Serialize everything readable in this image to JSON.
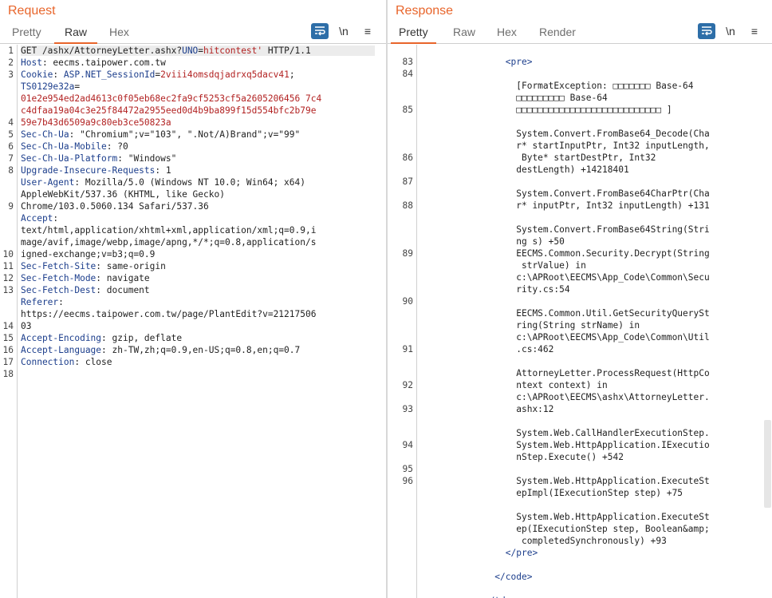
{
  "request": {
    "title": "Request",
    "tabs": [
      "Pretty",
      "Raw",
      "Hex"
    ],
    "active_tab": "Raw",
    "tools": {
      "newline": "\\n",
      "menu": "≡"
    },
    "line_numbers": [
      "1",
      "2",
      "3",
      "",
      "",
      "",
      "4",
      "5",
      "6",
      "7",
      "8",
      "",
      "",
      "9",
      "",
      "",
      "",
      "10",
      "11",
      "12",
      "13",
      "",
      "",
      "14",
      "15",
      "16",
      "17",
      "18"
    ],
    "rows": [
      {
        "parts": [
          [
            "m",
            "GET /ashx/AttorneyLetter.ashx?"
          ],
          [
            "k",
            "UNO"
          ],
          [
            "m",
            "="
          ],
          [
            "v",
            "hitcontest'"
          ],
          [
            "m",
            " HTTP/1.1"
          ]
        ]
      },
      {
        "parts": [
          [
            "k",
            "Host"
          ],
          [
            "m",
            ": eecms.taipower.com.tw"
          ]
        ]
      },
      {
        "parts": [
          [
            "k",
            "Cookie"
          ],
          [
            "m",
            ": "
          ],
          [
            "k",
            "ASP.NET_SessionId"
          ],
          [
            "m",
            "="
          ],
          [
            "v",
            "2viii4omsdqjadrxq5dacv41"
          ],
          [
            "m",
            ";"
          ]
        ]
      },
      {
        "parts": [
          [
            "k",
            "TS0129e32a"
          ],
          [
            "m",
            "="
          ]
        ]
      },
      {
        "parts": [
          [
            "v",
            "01e2e954ed2ad4613c0f05eb68ec2fa9cf5253cf5a2605206456 7c4"
          ]
        ]
      },
      {
        "parts": [
          [
            "v",
            "c4dfaa19a04c3e25f84472a2955eed0d4b9ba899f15d554bfc2b79e"
          ]
        ]
      },
      {
        "parts": [
          [
            "v",
            "59e7b43d6509a9c80eb3ce50823a"
          ]
        ]
      },
      {
        "parts": [
          [
            "k",
            "Sec-Ch-Ua"
          ],
          [
            "m",
            ": \"Chromium\";v=\"103\", \".Not/A)Brand\";v=\"99\""
          ]
        ]
      },
      {
        "parts": [
          [
            "k",
            "Sec-Ch-Ua-Mobile"
          ],
          [
            "m",
            ": ?0"
          ]
        ]
      },
      {
        "parts": [
          [
            "k",
            "Sec-Ch-Ua-Platform"
          ],
          [
            "m",
            ": \"Windows\""
          ]
        ]
      },
      {
        "parts": [
          [
            "k",
            "Upgrade-Insecure-Requests"
          ],
          [
            "m",
            ": 1"
          ]
        ]
      },
      {
        "parts": [
          [
            "k",
            "User-Agent"
          ],
          [
            "m",
            ": Mozilla/5.0 (Windows NT 10.0; Win64; x64)"
          ]
        ]
      },
      {
        "parts": [
          [
            "m",
            "AppleWebKit/537.36 (KHTML, like Gecko)"
          ]
        ]
      },
      {
        "parts": [
          [
            "m",
            "Chrome/103.0.5060.134 Safari/537.36"
          ]
        ]
      },
      {
        "parts": [
          [
            "k",
            "Accept"
          ],
          [
            "m",
            ":"
          ]
        ]
      },
      {
        "parts": [
          [
            "m",
            "text/html,application/xhtml+xml,application/xml;q=0.9,i"
          ]
        ]
      },
      {
        "parts": [
          [
            "m",
            "mage/avif,image/webp,image/apng,*/*;q=0.8,application/s"
          ]
        ]
      },
      {
        "parts": [
          [
            "m",
            "igned-exchange;v=b3;q=0.9"
          ]
        ]
      },
      {
        "parts": [
          [
            "k",
            "Sec-Fetch-Site"
          ],
          [
            "m",
            ": same-origin"
          ]
        ]
      },
      {
        "parts": [
          [
            "k",
            "Sec-Fetch-Mode"
          ],
          [
            "m",
            ": navigate"
          ]
        ]
      },
      {
        "parts": [
          [
            "k",
            "Sec-Fetch-Dest"
          ],
          [
            "m",
            ": document"
          ]
        ]
      },
      {
        "parts": [
          [
            "k",
            "Referer"
          ],
          [
            "m",
            ":"
          ]
        ]
      },
      {
        "parts": [
          [
            "m",
            "https://eecms.taipower.com.tw/page/PlantEdit?v=21217506"
          ]
        ]
      },
      {
        "parts": [
          [
            "m",
            "03"
          ]
        ]
      },
      {
        "parts": [
          [
            "k",
            "Accept-Encoding"
          ],
          [
            "m",
            ": gzip, deflate"
          ]
        ]
      },
      {
        "parts": [
          [
            "k",
            "Accept-Language"
          ],
          [
            "m",
            ": zh-TW,zh;q=0.9,en-US;q=0.8,en;q=0.7"
          ]
        ]
      },
      {
        "parts": [
          [
            "k",
            "Connection"
          ],
          [
            "m",
            ": close"
          ]
        ]
      },
      {
        "parts": [
          [
            "m",
            ""
          ]
        ]
      }
    ]
  },
  "response": {
    "title": "Response",
    "tabs": [
      "Pretty",
      "Raw",
      "Hex",
      "Render"
    ],
    "active_tab": "Pretty",
    "tools": {
      "newline": "\\n",
      "menu": "≡"
    },
    "line_numbers": [
      "83",
      "84",
      "",
      "",
      "85",
      "",
      "",
      "",
      "86",
      "",
      "87",
      "",
      "88",
      "",
      "",
      "",
      "89",
      "",
      "",
      "",
      "90",
      "",
      "",
      "",
      "91",
      "",
      "",
      "92",
      "",
      "93",
      "",
      "",
      "94",
      "",
      "95",
      "96"
    ],
    "rows": [
      {
        "parts": [
          [
            "m",
            "                "
          ],
          [
            "t",
            "<pre>"
          ]
        ]
      },
      {
        "parts": [
          [
            "m",
            ""
          ]
        ]
      },
      {
        "parts": [
          [
            "m",
            "                  [FormatException: □□□□□□□ Base-64"
          ]
        ]
      },
      {
        "parts": [
          [
            "m",
            "                  □□□□□□□□□ Base-64"
          ]
        ]
      },
      {
        "parts": [
          [
            "m",
            "                  □□□□□□□□□□□□□□□□□□□□□□□□□□□ ]"
          ]
        ]
      },
      {
        "parts": [
          [
            "m",
            ""
          ]
        ]
      },
      {
        "parts": [
          [
            "m",
            "                  System.Convert.FromBase64_Decode(Cha"
          ]
        ]
      },
      {
        "parts": [
          [
            "m",
            "                  r* startInputPtr, Int32 inputLength,"
          ]
        ]
      },
      {
        "parts": [
          [
            "m",
            "                   Byte* startDestPtr, Int32"
          ]
        ]
      },
      {
        "parts": [
          [
            "m",
            "                  destLength) +14218401"
          ]
        ]
      },
      {
        "parts": [
          [
            "m",
            ""
          ]
        ]
      },
      {
        "parts": [
          [
            "m",
            "                  System.Convert.FromBase64CharPtr(Cha"
          ]
        ]
      },
      {
        "parts": [
          [
            "m",
            "                  r* inputPtr, Int32 inputLength) +131"
          ]
        ]
      },
      {
        "parts": [
          [
            "m",
            ""
          ]
        ]
      },
      {
        "parts": [
          [
            "m",
            "                  System.Convert.FromBase64String(Stri"
          ]
        ]
      },
      {
        "parts": [
          [
            "m",
            "                  ng s) +50"
          ]
        ]
      },
      {
        "parts": [
          [
            "m",
            "                  EECMS.Common.Security.Decrypt(String"
          ]
        ]
      },
      {
        "parts": [
          [
            "m",
            "                   strValue) in"
          ]
        ]
      },
      {
        "parts": [
          [
            "m",
            "                  c:\\APRoot\\EECMS\\App_Code\\Common\\Secu"
          ]
        ]
      },
      {
        "parts": [
          [
            "m",
            "                  rity.cs:54"
          ]
        ]
      },
      {
        "parts": [
          [
            "m",
            ""
          ]
        ]
      },
      {
        "parts": [
          [
            "m",
            "                  EECMS.Common.Util.GetSecurityQuerySt"
          ]
        ]
      },
      {
        "parts": [
          [
            "m",
            "                  ring(String strName) in"
          ]
        ]
      },
      {
        "parts": [
          [
            "m",
            "                  c:\\APRoot\\EECMS\\App_Code\\Common\\Util"
          ]
        ]
      },
      {
        "parts": [
          [
            "m",
            "                  .cs:462"
          ]
        ]
      },
      {
        "parts": [
          [
            "m",
            ""
          ]
        ]
      },
      {
        "parts": [
          [
            "m",
            "                  AttorneyLetter.ProcessRequest(HttpCo"
          ]
        ]
      },
      {
        "parts": [
          [
            "m",
            "                  ntext context) in"
          ]
        ]
      },
      {
        "parts": [
          [
            "m",
            "                  c:\\APRoot\\EECMS\\ashx\\AttorneyLetter."
          ]
        ]
      },
      {
        "parts": [
          [
            "m",
            "                  ashx:12"
          ]
        ]
      },
      {
        "parts": [
          [
            "m",
            ""
          ]
        ]
      },
      {
        "parts": [
          [
            "m",
            "                  System.Web.CallHandlerExecutionStep."
          ]
        ]
      },
      {
        "parts": [
          [
            "m",
            "                  System.Web.HttpApplication.IExecutio"
          ]
        ]
      },
      {
        "parts": [
          [
            "m",
            "                  nStep.Execute() +542"
          ]
        ]
      },
      {
        "parts": [
          [
            "m",
            ""
          ]
        ]
      },
      {
        "parts": [
          [
            "m",
            "                  System.Web.HttpApplication.ExecuteSt"
          ]
        ]
      },
      {
        "parts": [
          [
            "m",
            "                  epImpl(IExecutionStep step) +75"
          ]
        ]
      },
      {
        "parts": [
          [
            "m",
            ""
          ]
        ]
      },
      {
        "parts": [
          [
            "m",
            "                  System.Web.HttpApplication.ExecuteSt"
          ]
        ]
      },
      {
        "parts": [
          [
            "m",
            "                  ep(IExecutionStep step, Boolean&amp;"
          ]
        ]
      },
      {
        "parts": [
          [
            "m",
            "                   completedSynchronously) +93"
          ]
        ]
      },
      {
        "parts": [
          [
            "m",
            "                "
          ],
          [
            "t",
            "</pre>"
          ]
        ]
      },
      {
        "parts": [
          [
            "m",
            ""
          ]
        ]
      },
      {
        "parts": [
          [
            "m",
            "              "
          ],
          [
            "t",
            "</code>"
          ]
        ]
      },
      {
        "parts": [
          [
            "m",
            ""
          ]
        ]
      },
      {
        "parts": [
          [
            "m",
            "            "
          ],
          [
            "t",
            "</td>"
          ]
        ]
      }
    ]
  }
}
